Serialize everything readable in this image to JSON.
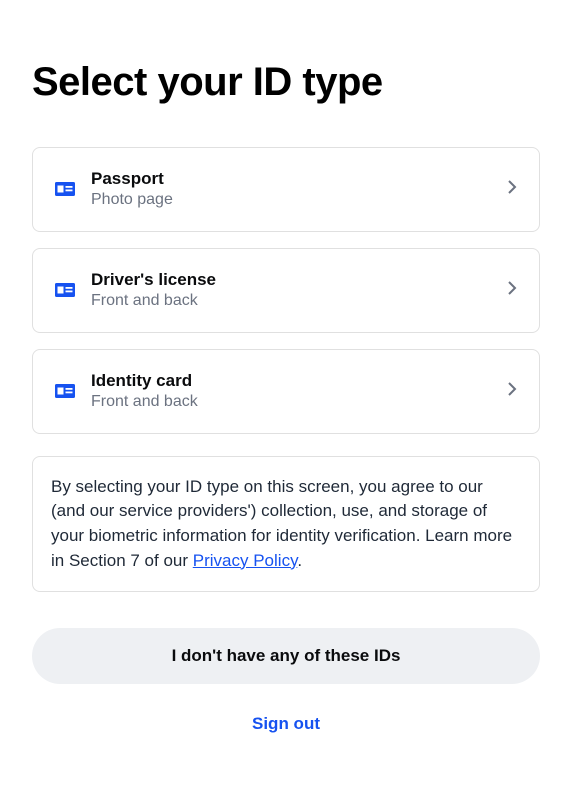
{
  "title": "Select your ID type",
  "options": [
    {
      "title": "Passport",
      "sub": "Photo page"
    },
    {
      "title": "Driver's license",
      "sub": "Front and back"
    },
    {
      "title": "Identity card",
      "sub": "Front and back"
    }
  ],
  "disclaimer": {
    "text_before": "By selecting your ID type on this screen, you agree to our (and our service providers') collection, use, and storage of your biometric information for identity verification. Learn more in Section 7 of our ",
    "link_text": "Privacy Policy",
    "text_after": "."
  },
  "buttons": {
    "no_id": "I don't have any of these IDs",
    "sign_out": "Sign out"
  }
}
